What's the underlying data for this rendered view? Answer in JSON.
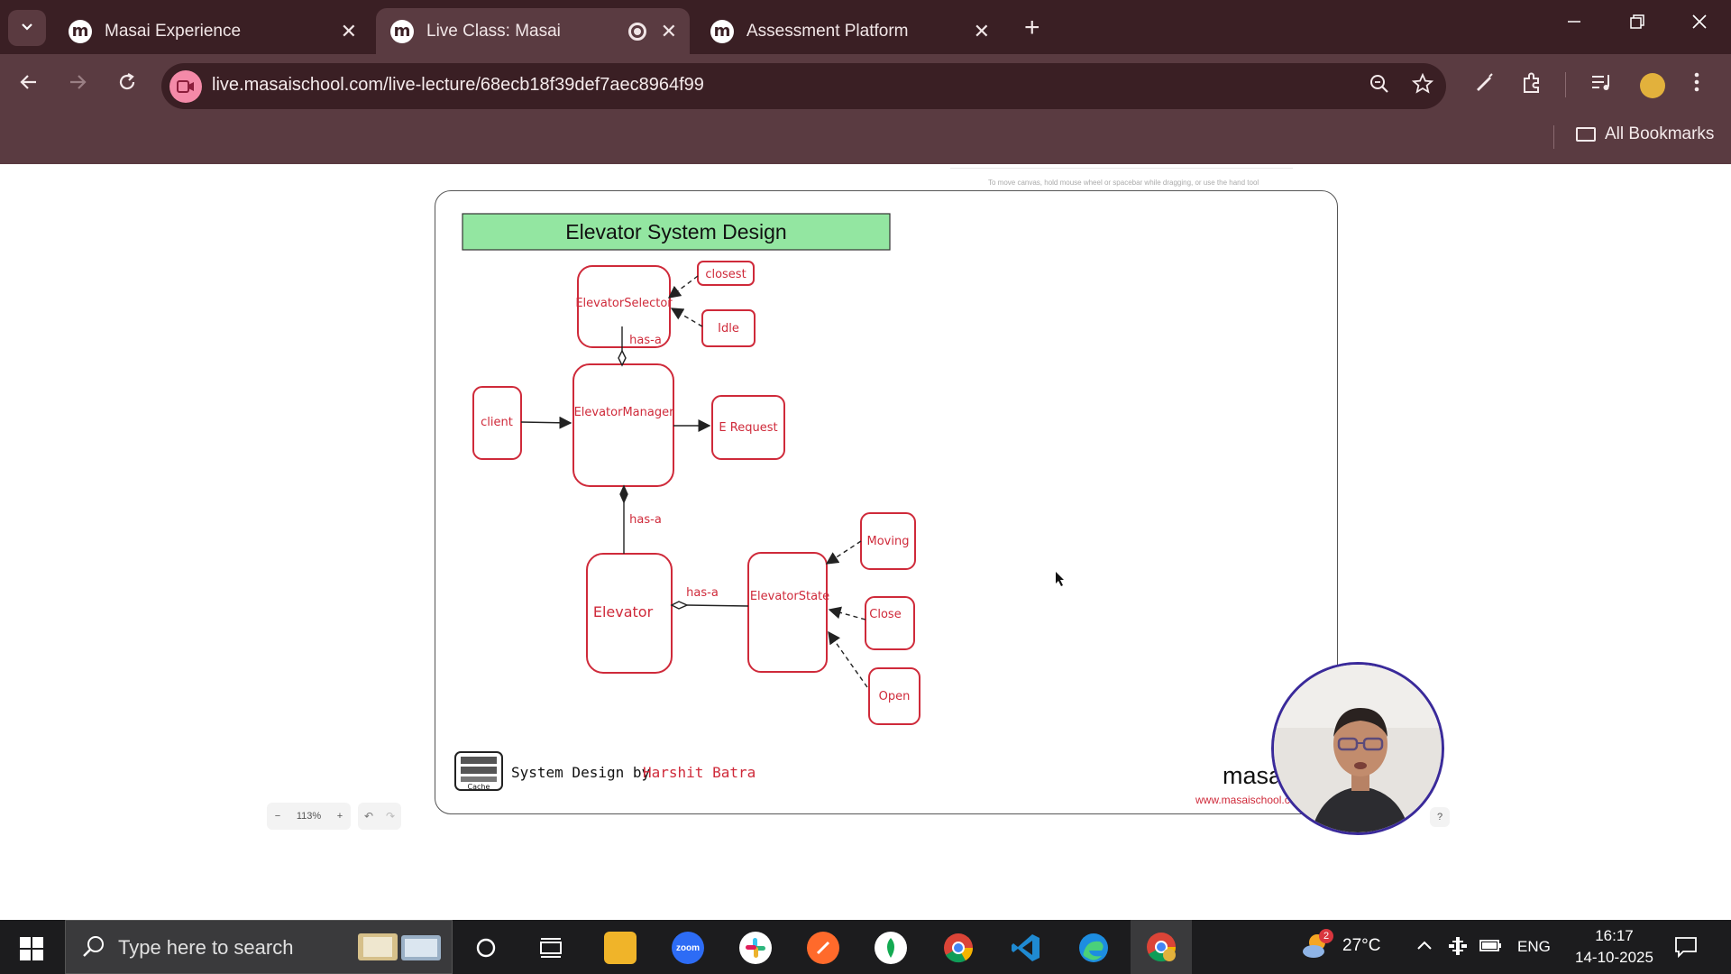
{
  "tabs": [
    {
      "label": "Masai Experience",
      "active": false
    },
    {
      "label": "Live Class: Masai",
      "active": true
    },
    {
      "label": "Assessment Platform",
      "active": false
    }
  ],
  "address_bar": {
    "url": "live.masaischool.com/live-lecture/68ecb18f39def7aec8964f99"
  },
  "bookmarks": {
    "all_bookmarks_label": "All Bookmarks"
  },
  "canvas": {
    "hint": "To move canvas, hold mouse wheel or spacebar while dragging, or use the hand tool",
    "zoom_label": "113%"
  },
  "diagram": {
    "title": "Elevator System Design",
    "nodes": {
      "selector": "ElevatorSelector",
      "closest": "closest",
      "idle": "Idle",
      "client": "client",
      "manager": "ElevatorManager",
      "erequest": "E Request",
      "elevator": "Elevator",
      "state": "ElevatorState",
      "moving": "Moving",
      "close": "Close",
      "open": "Open"
    },
    "edge_labels": {
      "has_a_1": "has-a",
      "has_a_2": "has-a",
      "has_a_3": "has-a"
    },
    "footer_prefix": "System Design by",
    "footer_author": "Harshit Batra",
    "logo_caption": "Cache",
    "brand": "masai",
    "brand_url": "www.masaischool.com"
  },
  "taskbar": {
    "search_placeholder": "Type here to search",
    "weather": "27°C",
    "weather_badge": "2",
    "language": "ENG",
    "time": "16:17",
    "date": "14-10-2025",
    "zoom_app_label": "zoom"
  },
  "colors": {
    "tab_bg": "#3a1f24",
    "toolbar_bg": "#5a3b41",
    "diagram_red": "#cf2a3a",
    "title_green": "#93e6a1"
  }
}
